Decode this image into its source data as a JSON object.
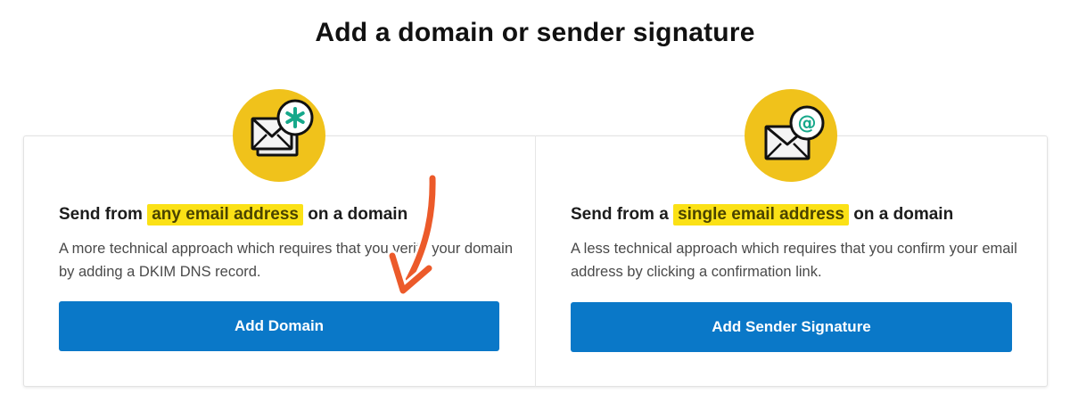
{
  "page": {
    "title": "Add a domain or sender signature"
  },
  "cards": [
    {
      "icon": "envelope-asterisk-icon",
      "heading_before": "Send from ",
      "heading_highlight": "any email address",
      "heading_after": " on a domain",
      "description": "A more technical approach which requires that you verify your domain by adding a DKIM DNS record.",
      "button_label": "Add Domain"
    },
    {
      "icon": "envelope-at-icon",
      "heading_before": "Send from a ",
      "heading_highlight": "single email address",
      "heading_after": " on a domain",
      "description": "A less technical approach which requires that you confirm your email address by clicking a confirmation link.",
      "button_label": "Add Sender Signature"
    }
  ],
  "colors": {
    "badge": "#f0c21b",
    "highlight": "#fbe116",
    "button": "#0a78c8",
    "icon_accent": "#16a88a",
    "annotation_arrow": "#ec5a2a"
  }
}
